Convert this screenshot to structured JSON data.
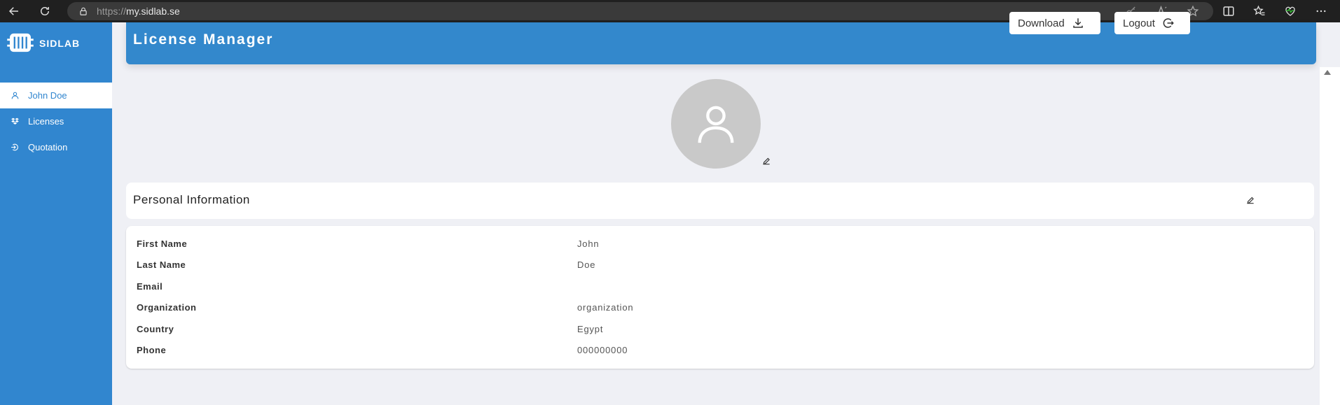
{
  "browser": {
    "url_protocol": "https://",
    "url_domain": "my.sidlab.se"
  },
  "sidebar": {
    "brand_name": "SIDLAB",
    "items": [
      {
        "label": "John Doe",
        "icon": "user-icon",
        "active": true
      },
      {
        "label": "Licenses",
        "icon": "dropbox-icon",
        "active": false
      },
      {
        "label": "Quotation",
        "icon": "login-icon",
        "active": false
      }
    ]
  },
  "header": {
    "title": "License Manager",
    "download_label": "Download",
    "logout_label": "Logout"
  },
  "profile": {
    "section_title": "Personal Information",
    "fields": [
      {
        "label": "First Name",
        "value": "John"
      },
      {
        "label": "Last Name",
        "value": "Doe"
      },
      {
        "label": "Email",
        "value": ""
      },
      {
        "label": "Organization",
        "value": "organization"
      },
      {
        "label": "Country",
        "value": "Egypt"
      },
      {
        "label": "Phone",
        "value": "000000000"
      }
    ]
  },
  "colors": {
    "accent": "#3186cf",
    "page_bg": "#eff0f5",
    "avatar_bg": "#c9c9c9"
  }
}
